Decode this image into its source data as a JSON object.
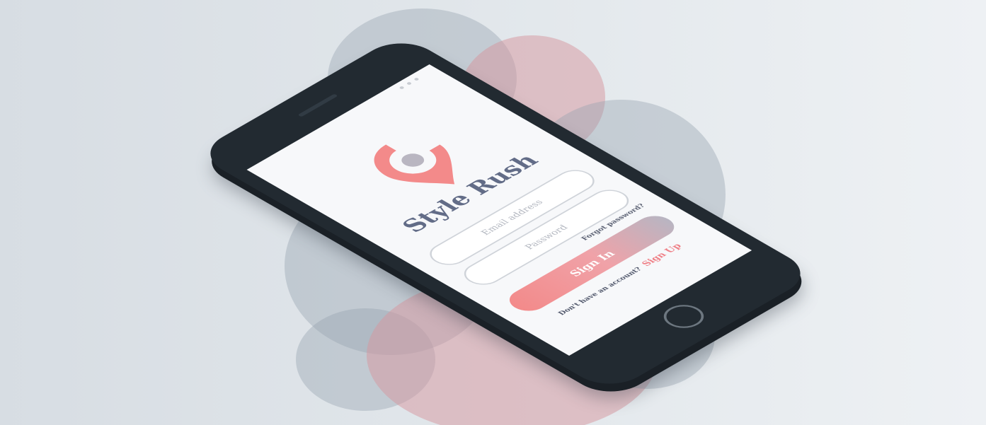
{
  "app": {
    "name": "Style Rush"
  },
  "login": {
    "email_placeholder": "Email address",
    "password_placeholder": "Password",
    "forgot_label": "Forgot password?",
    "sign_in_label": "Sign In",
    "no_account_text": "Don't have an account?",
    "sign_up_label": "Sign Up"
  },
  "colors": {
    "brand_coral": "#f38a8a",
    "brand_title": "#626c87",
    "phone_body": "#222a31",
    "screen_bg": "#f7f8fa",
    "blob_gray": "#96a3b0",
    "blob_pink": "#d6969e"
  },
  "icons": {
    "logo": "location-pin-logo-icon",
    "home": "home-button-icon"
  }
}
